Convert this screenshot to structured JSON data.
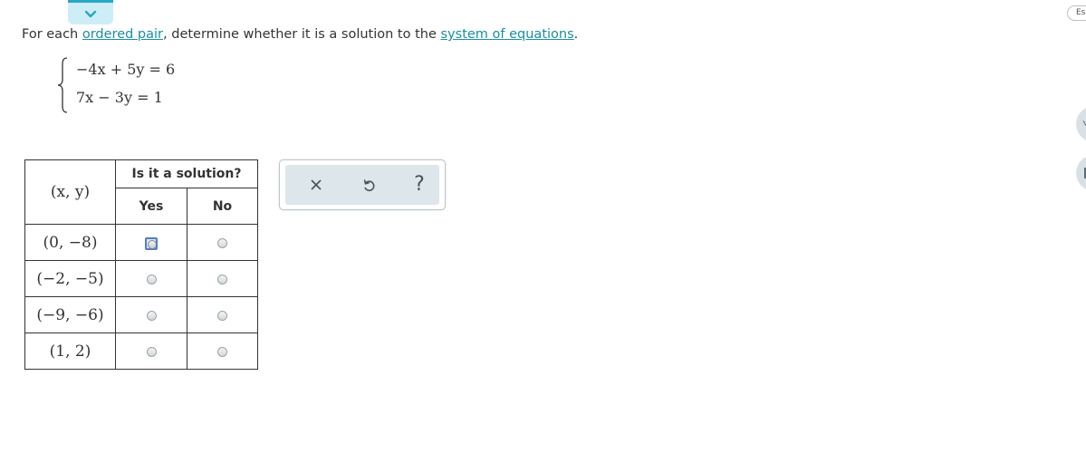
{
  "header": {
    "es_label": "Es"
  },
  "question": {
    "prefix": "For each ",
    "link1": "ordered pair",
    "middle": ", determine whether it is a solution to the ",
    "link2": "system of equations",
    "suffix": "."
  },
  "system": {
    "equations": [
      "−4x + 5y = 6",
      "7x − 3y = 1"
    ]
  },
  "table": {
    "header_top": "Is it a solution?",
    "pair_header": "(x, y)",
    "col_yes": "Yes",
    "col_no": "No",
    "rows": [
      {
        "pair": "(0, −8)",
        "selected": null,
        "focused": "yes"
      },
      {
        "pair": "(−2, −5)",
        "selected": null
      },
      {
        "pair": "(−9, −6)",
        "selected": null
      },
      {
        "pair": "(1, 2)",
        "selected": null
      }
    ]
  },
  "actions": {
    "help_label": "?"
  },
  "colors": {
    "link": "#1a8fa0",
    "tab_bg": "#cdeef6",
    "tab_border": "#2aa6c8",
    "panel_bg": "#dde6ea"
  }
}
